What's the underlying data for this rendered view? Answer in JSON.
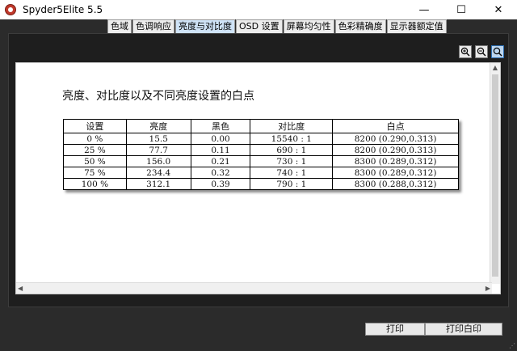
{
  "window": {
    "title": "Spyder5Elite 5.5",
    "controls": {
      "minimize": "—",
      "maximize": "☐",
      "close": "✕"
    }
  },
  "tabs": [
    {
      "label": "色域"
    },
    {
      "label": "色调响应"
    },
    {
      "label": "亮度与对比度",
      "active": true
    },
    {
      "label": "OSD 设置"
    },
    {
      "label": "屏幕均匀性"
    },
    {
      "label": "色彩精确度"
    },
    {
      "label": "显示器额定值"
    }
  ],
  "zoom": {
    "icons": [
      "zoom-in-icon",
      "zoom-out-icon",
      "zoom-fit-icon"
    ]
  },
  "report": {
    "title": "亮度、对比度以及不同亮度设置的白点",
    "headers": [
      "设置",
      "亮度",
      "黑色",
      "对比度",
      "白点"
    ],
    "rows": [
      [
        "0 %",
        "15.5",
        "0.00",
        "15540 : 1",
        "8200 (0.290,0.313)"
      ],
      [
        "25 %",
        "77.7",
        "0.11",
        "690 : 1",
        "8200 (0.290,0.313)"
      ],
      [
        "50 %",
        "156.0",
        "0.21",
        "730 : 1",
        "8300 (0.289,0.312)"
      ],
      [
        "75 %",
        "234.4",
        "0.32",
        "740 : 1",
        "8300 (0.289,0.312)"
      ],
      [
        "100 %",
        "312.1",
        "0.39",
        "790 : 1",
        "8300 (0.288,0.312)"
      ]
    ]
  },
  "buttons": {
    "print": "打印",
    "print_white": "打印白印"
  },
  "colors": {
    "background": "#2b2b2b",
    "active_tab": "#cfe3f7"
  }
}
